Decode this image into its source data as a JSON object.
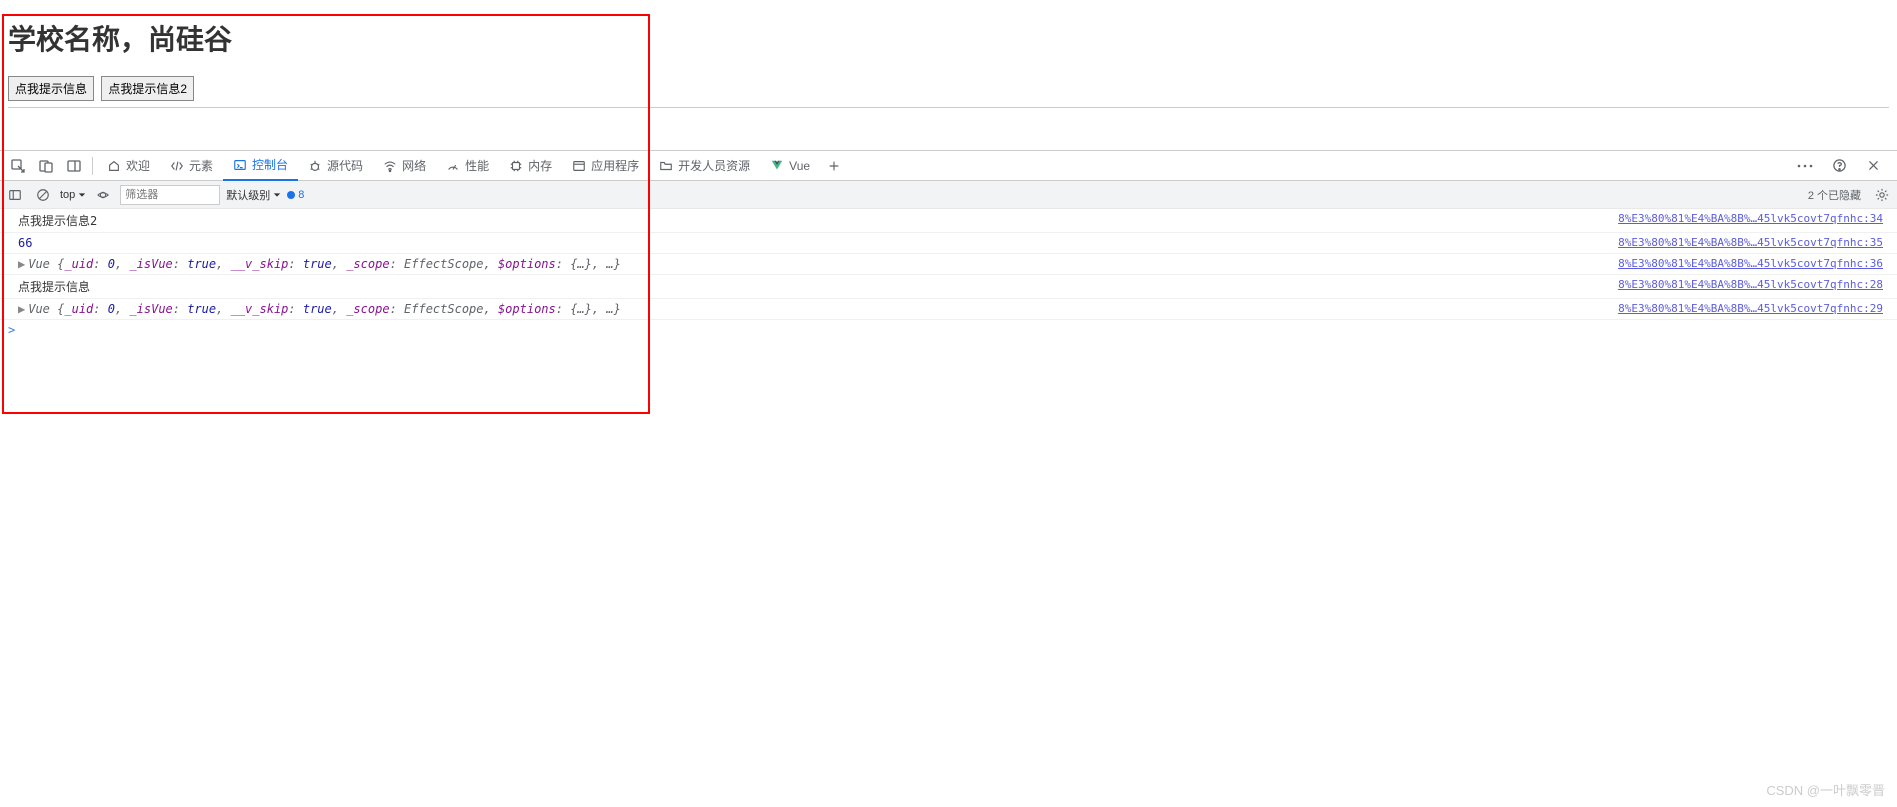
{
  "page": {
    "title": "学校名称，尚硅谷",
    "button1": "点我提示信息",
    "button2": "点我提示信息2"
  },
  "devtools": {
    "tabs": {
      "welcome": "欢迎",
      "elements": "元素",
      "console": "控制台",
      "sources": "源代码",
      "network": "网络",
      "performance": "性能",
      "memory": "内存",
      "application": "应用程序",
      "devresources": "开发人员资源",
      "vue": "Vue"
    },
    "filterbar": {
      "context": "top",
      "filter_placeholder": "筛选器",
      "level": "默认级别",
      "badge_count": "8",
      "hidden_text": "2 个已隐藏"
    },
    "console": [
      {
        "type": "log",
        "text": "点我提示信息2",
        "src": "8%E3%80%81%E4%BA%8B%…45lvk5covt7qfnhc:34"
      },
      {
        "type": "num",
        "text": "66",
        "src": "8%E3%80%81%E4%BA%8B%…45lvk5covt7qfnhc:35"
      },
      {
        "type": "obj",
        "prefix": "Vue ",
        "body": "{_uid: 0, _isVue: true, __v_skip: true, _scope: EffectScope, $options: {…}, …}",
        "src": "8%E3%80%81%E4%BA%8B%…45lvk5covt7qfnhc:36"
      },
      {
        "type": "log",
        "text": "点我提示信息",
        "src": "8%E3%80%81%E4%BA%8B%…45lvk5covt7qfnhc:28"
      },
      {
        "type": "obj",
        "prefix": "Vue ",
        "body": "{_uid: 0, _isVue: true, __v_skip: true, _scope: EffectScope, $options: {…}, …}",
        "src": "8%E3%80%81%E4%BA%8B%…45lvk5covt7qfnhc:29"
      }
    ]
  },
  "watermark": "CSDN @一叶飘零晋"
}
